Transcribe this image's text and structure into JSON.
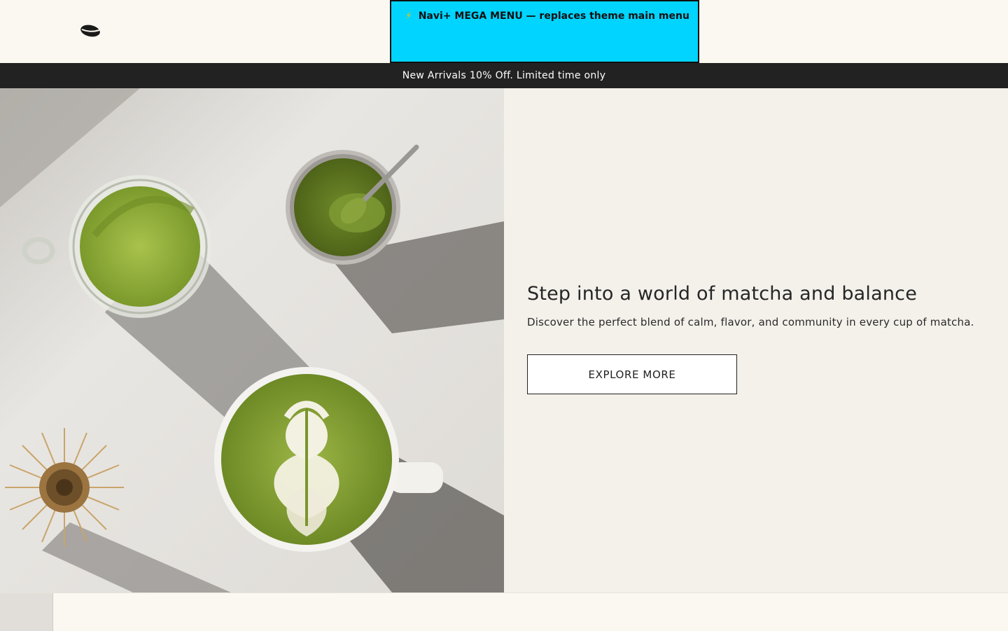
{
  "header": {
    "logo_icon": "coffee-bean-icon",
    "mega_menu_bolt": "⚡",
    "mega_menu_label": "Navi+ MEGA MENU — replaces theme main menu",
    "mega_menu_color": "#00d4ff"
  },
  "announcement": {
    "text": "New Arrivals 10% Off. Limited time only"
  },
  "hero": {
    "image_icon": "matcha-drinks-photo",
    "heading": "Step into a world of matcha and balance",
    "subheading": "Discover the perfect blend of calm, flavor, and community in every cup of matcha.",
    "button_label": "EXPLORE MORE"
  },
  "colors": {
    "page_bg": "#fbf8f2",
    "announcement_bg": "#222222",
    "hero_panel_bg": "#f4f1eb",
    "matcha_green": "#8aa43a"
  }
}
